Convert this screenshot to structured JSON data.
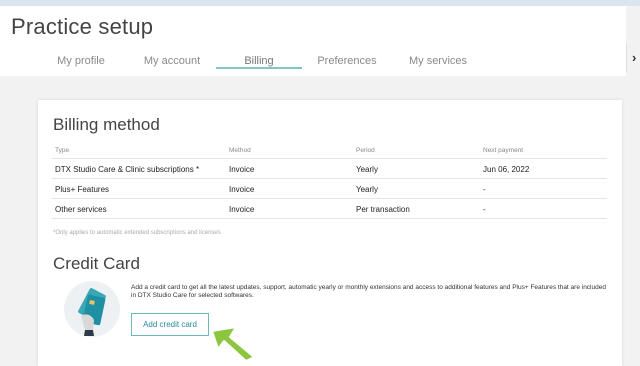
{
  "page": {
    "title": "Practice setup"
  },
  "tabs": [
    {
      "label": "My profile",
      "active": false
    },
    {
      "label": "My account",
      "active": false
    },
    {
      "label": "Billing",
      "active": true
    },
    {
      "label": "Preferences",
      "active": false
    },
    {
      "label": "My services",
      "active": false
    }
  ],
  "icons": {
    "next": "chevron-right-icon",
    "credit_card": "credit-card-icon",
    "pointer": "arrow-icon"
  },
  "billing": {
    "title": "Billing method",
    "columns": [
      "Type",
      "Method",
      "Period",
      "Next payment"
    ],
    "rows": [
      [
        "DTX Studio Care & Clinic subscriptions *",
        "Invoice",
        "Yearly",
        "Jun 06, 2022"
      ],
      [
        "Plus+ Features",
        "Invoice",
        "Yearly",
        "-"
      ],
      [
        "Other services",
        "Invoice",
        "Per transaction",
        "-"
      ]
    ],
    "footnote": "*Only applies to automatic extended subscriptions and licenses"
  },
  "credit_card": {
    "title": "Credit Card",
    "description": "Add a credit card to get all the latest updates, support, automatic yearly or monthly extensions and access to additional features and Plus+ Features that are included in DTX Studio Care for selected softwares.",
    "button_label": "Add credit card"
  },
  "colors": {
    "accent": "#7fc7c7",
    "button_text": "#2a8a95",
    "arrow": "#8cc63f"
  }
}
